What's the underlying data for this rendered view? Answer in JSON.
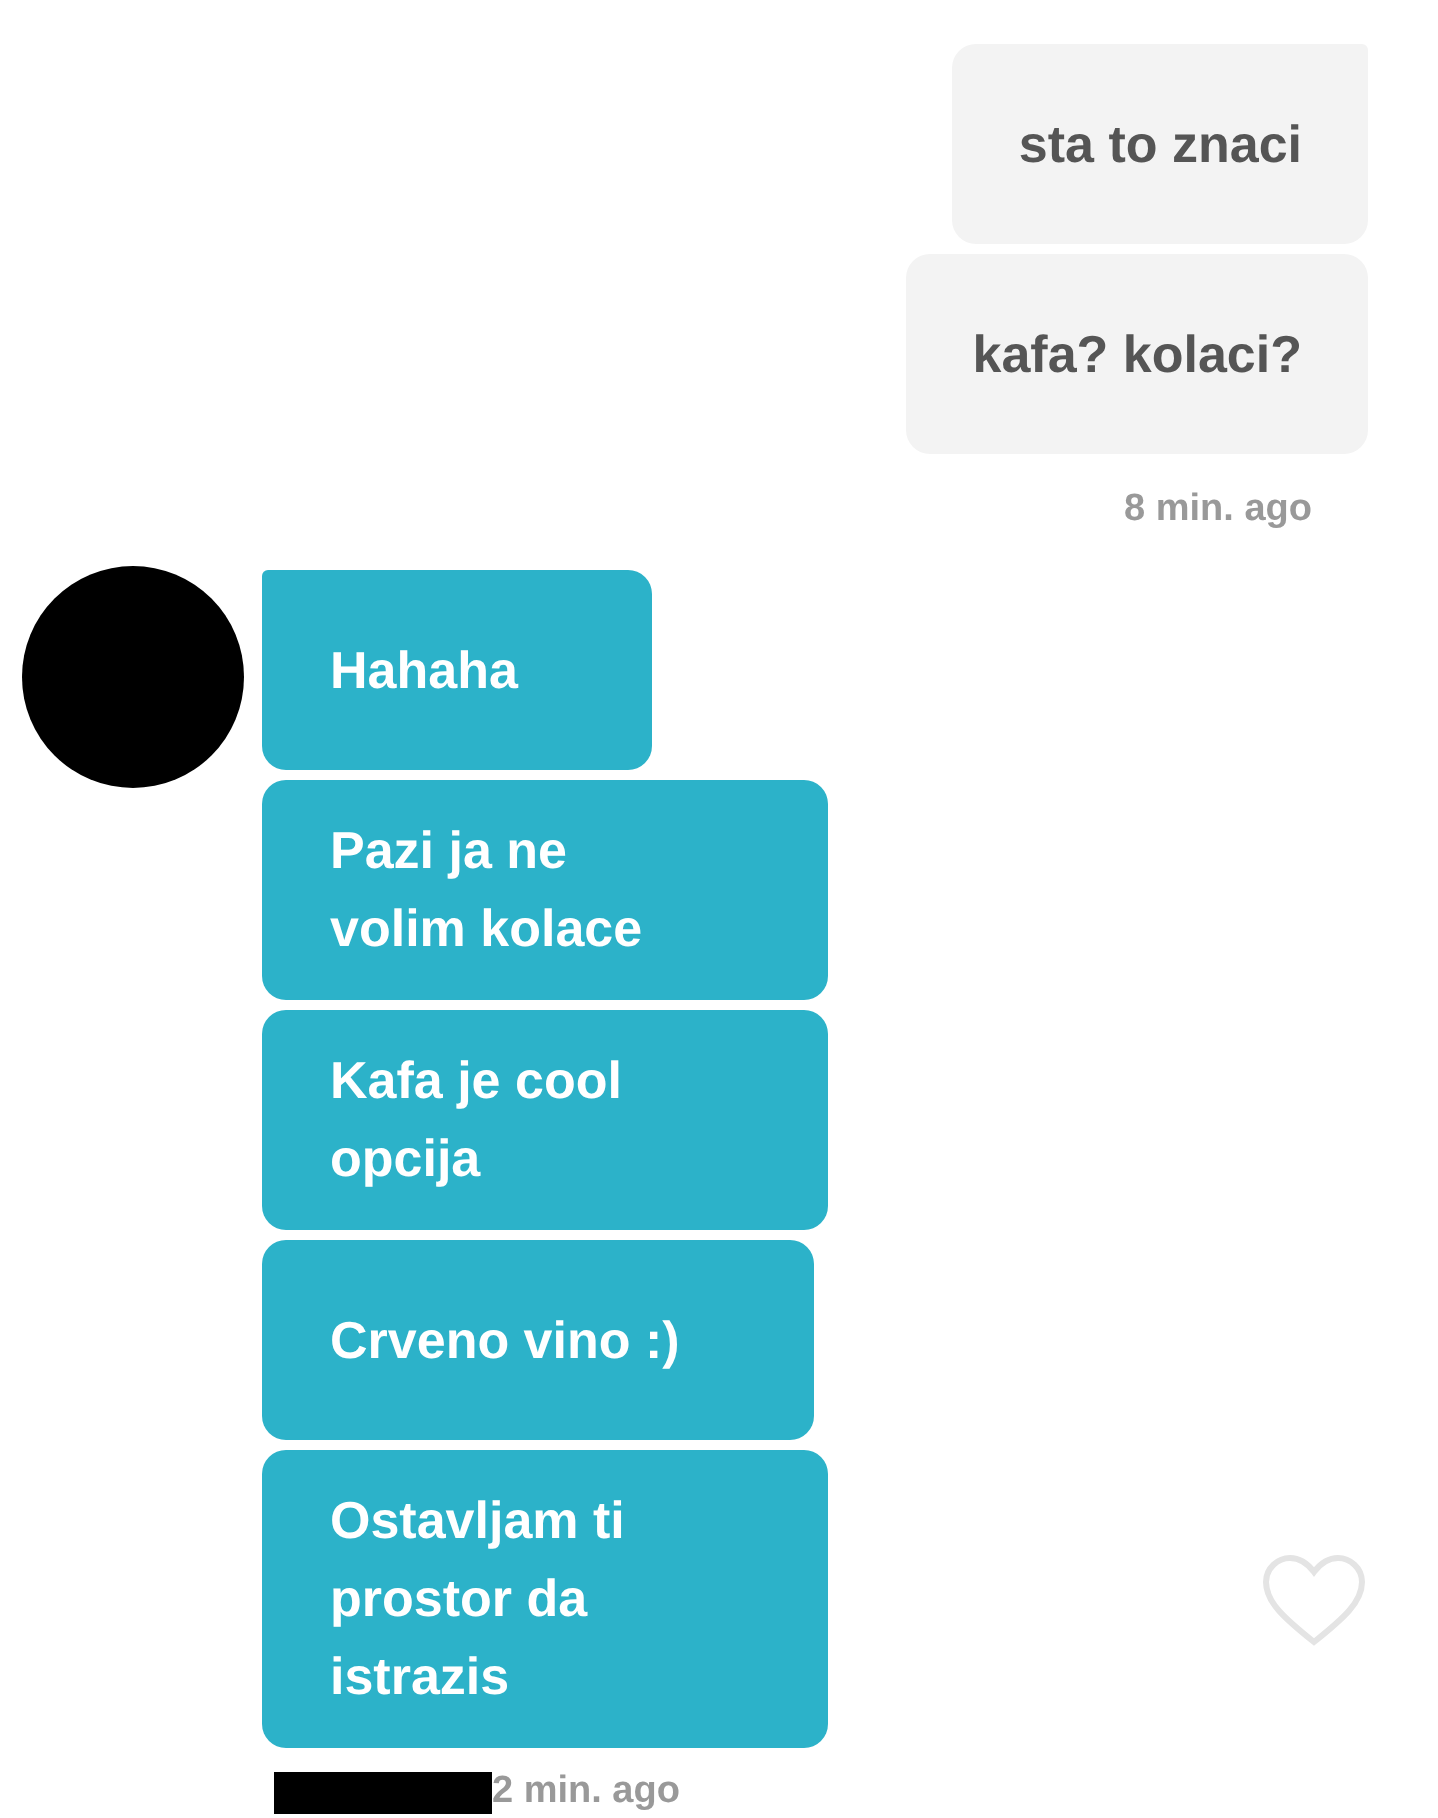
{
  "groups": [
    {
      "kind": "sent",
      "messages": [
        {
          "text": "sta to znaci"
        },
        {
          "text": "kafa? kolaci?"
        }
      ],
      "time": "8 min. ago"
    },
    {
      "kind": "received",
      "messages": [
        {
          "text": "Hahaha"
        },
        {
          "text": "Pazi ja ne volim kolace"
        },
        {
          "text": "Kafa je cool opcija"
        },
        {
          "text": "Crveno vino :)"
        },
        {
          "text": "Ostavljam ti prostor da istrazis",
          "liked": false
        }
      ],
      "time": "2 min. ago"
    }
  ]
}
